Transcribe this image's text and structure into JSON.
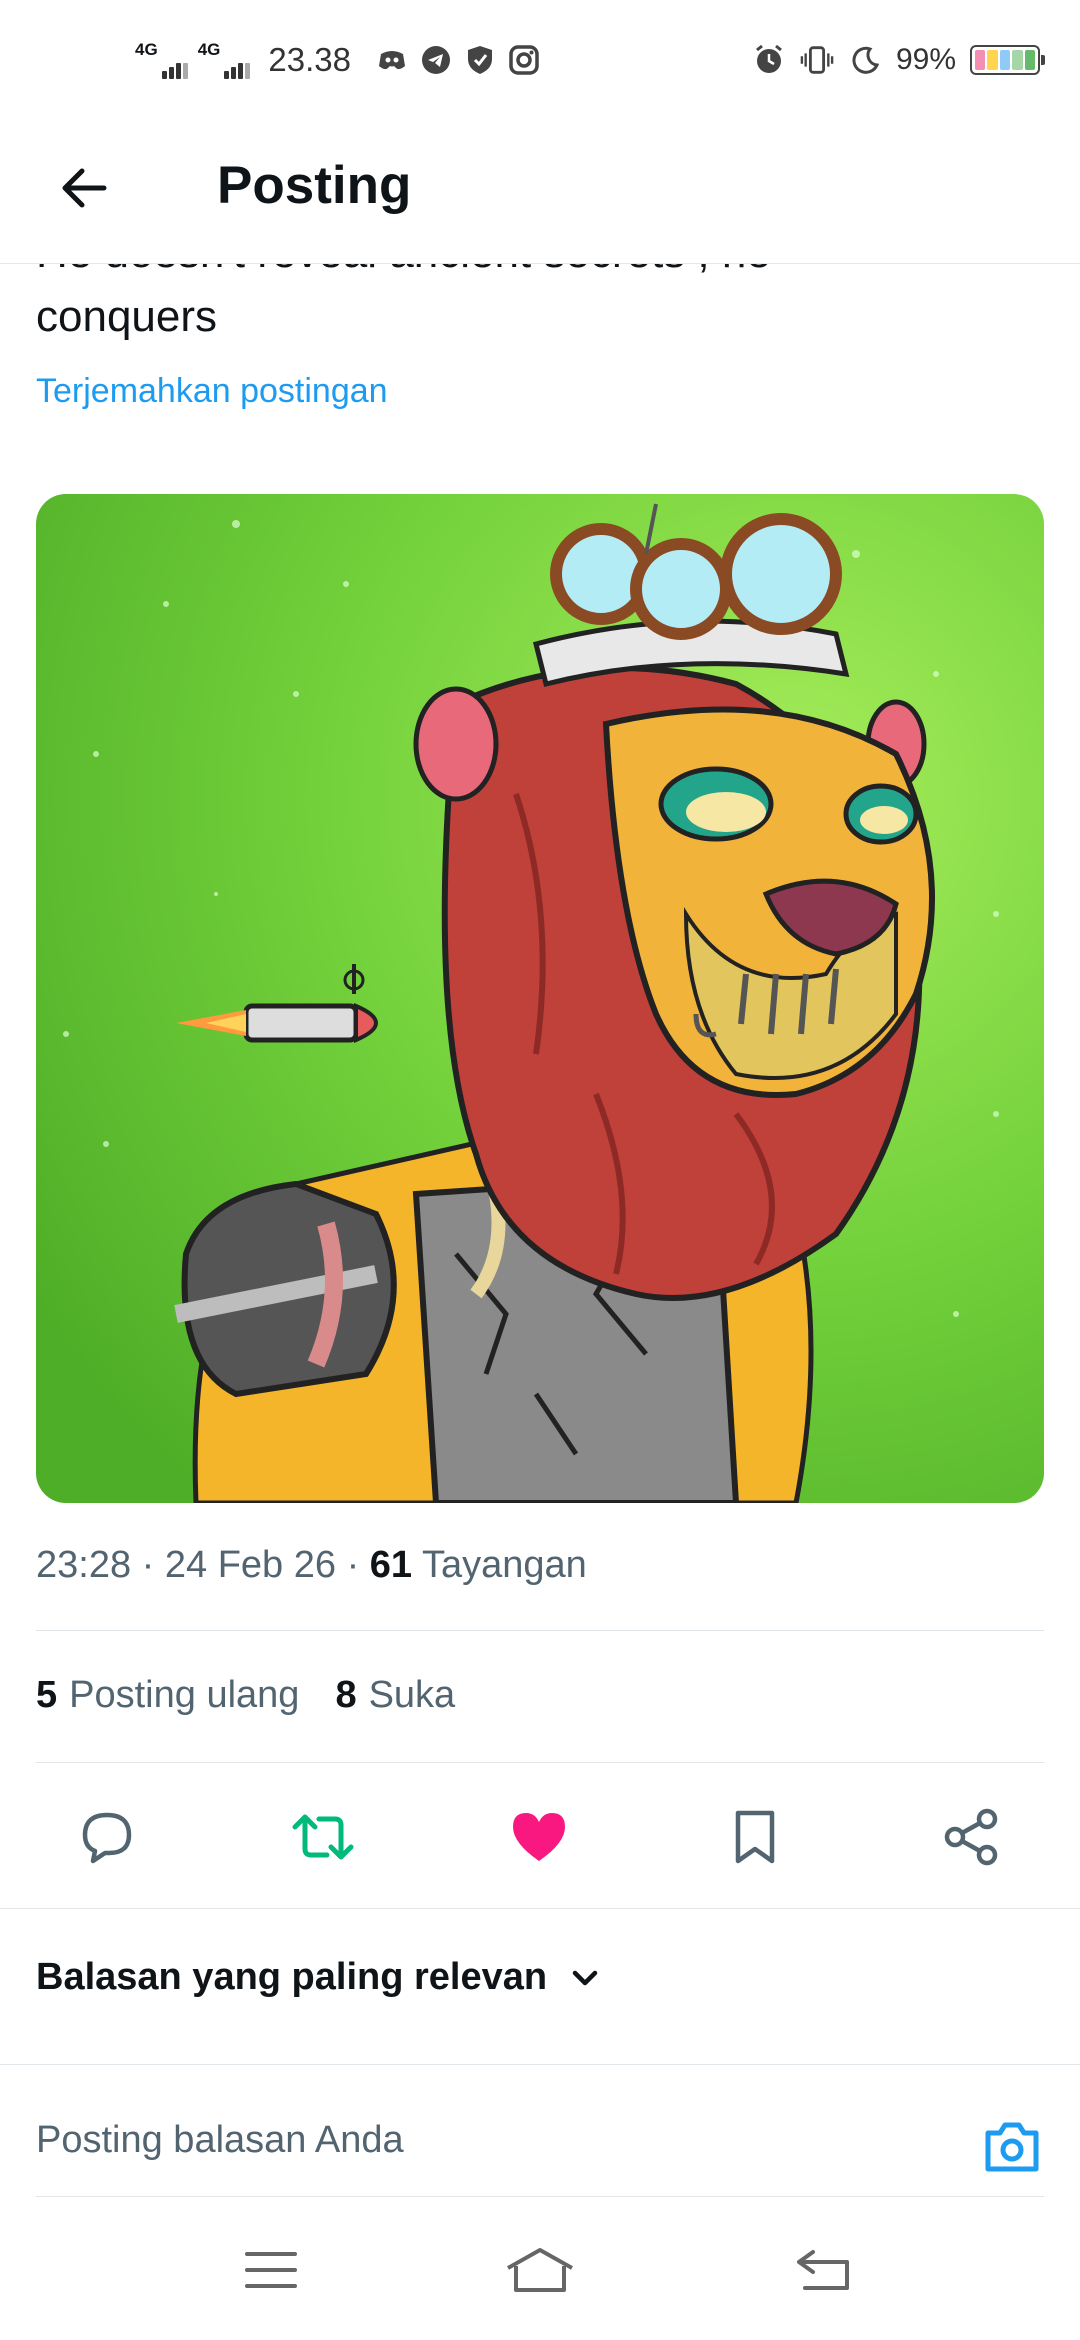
{
  "status_bar": {
    "network1": "4G",
    "network2": "4G",
    "time": "23.38",
    "battery_percent": "99%"
  },
  "header": {
    "title": "Posting"
  },
  "post": {
    "text_cut_line": "He doesn't reveal ancient secrets , he",
    "text_line": "conquers",
    "translate_link": "Terjemahkan postingan",
    "time": "23:28",
    "date": "24 Feb 26",
    "views_count": "61",
    "views_label": "Tayangan",
    "reposts_count": "5",
    "reposts_label": "Posting ulang",
    "likes_count": "8",
    "likes_label": "Suka"
  },
  "replies": {
    "sort_label": "Balasan yang paling relevan",
    "input_placeholder": "Posting balasan Anda"
  },
  "colors": {
    "link": "#1d9bf0",
    "repost_active": "#00ba7c",
    "like_active": "#f91880",
    "icon_gray": "#536471"
  },
  "icons": {
    "back": "arrow-left-icon",
    "reply": "comment-icon",
    "repost": "repost-icon",
    "like": "heart-icon",
    "bookmark": "bookmark-icon",
    "share": "share-icon",
    "sort": "chevron-down-icon",
    "camera": "camera-icon",
    "nav_menu": "menu-icon",
    "nav_home": "home-icon",
    "nav_back": "back-icon"
  }
}
